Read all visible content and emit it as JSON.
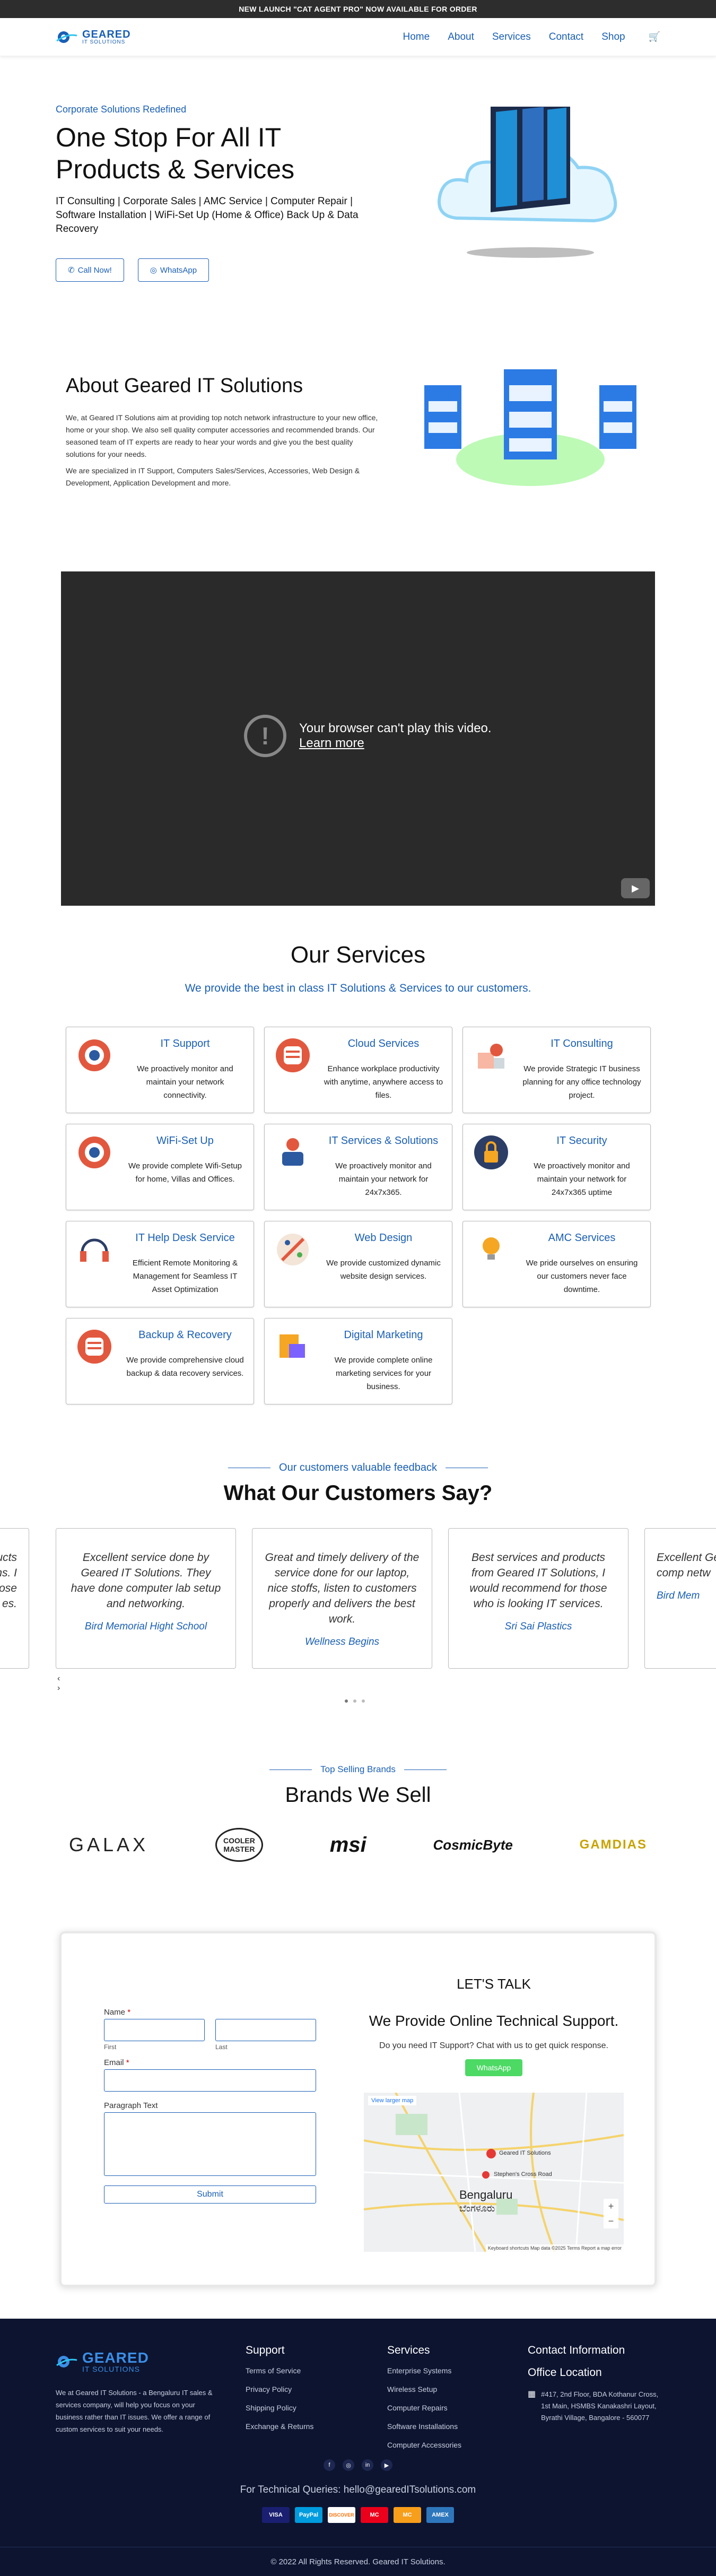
{
  "topbar": {
    "text": "NEW LAUNCH \"CAT AGENT PRO\" NOW AVAILABLE FOR ORDER"
  },
  "header": {
    "logo_line1": "GEARED",
    "logo_line2": "IT SOLUTIONS",
    "nav": [
      "Home",
      "About",
      "Services",
      "Contact",
      "Shop"
    ]
  },
  "hero": {
    "eyebrow": "Corporate Solutions Redefined",
    "title": "One Stop For All IT Products & Services",
    "desc": "IT Consulting | Corporate Sales | AMC Service | Computer Repair | Software Installation | WiFi-Set Up (Home & Office) Back Up & Data Recovery",
    "btn_call": "Call Now!",
    "btn_whatsapp": "WhatsApp"
  },
  "about": {
    "title": "About Geared IT Solutions",
    "p1": "We, at Geared IT Solutions aim at providing top notch network infrastructure to your new office, home or your shop. We also sell quality computer accessories and recommended brands. Our seasoned team of IT experts are ready to hear your words and give you the best quality solutions for your needs.",
    "p2": "We are specialized in IT Support, Computers Sales/Services, Accessories, Web Design & Development, Application Development and more."
  },
  "video": {
    "msg1": "Your browser can't play this video.",
    "msg2": "Learn more"
  },
  "services": {
    "title": "Our Services",
    "subtitle": "We provide the best in class IT Solutions & Services to our customers.",
    "items": [
      {
        "title": "IT Support",
        "desc": "We proactively monitor and maintain your network connectivity.",
        "icon": "gear-icon",
        "color": "#e2583e"
      },
      {
        "title": "Cloud Services",
        "desc": "Enhance workplace productivity with anytime, anywhere access to files.",
        "icon": "database-icon",
        "color": "#e2583e"
      },
      {
        "title": "IT Consulting",
        "desc": "We provide Strategic IT business planning for any office technology project.",
        "icon": "consulting-icon",
        "color": "#e2583e"
      },
      {
        "title": "WiFi-Set Up",
        "desc": "We provide complete Wifi-Setup for home, Villas and Offices.",
        "icon": "gear-icon",
        "color": "#e2583e"
      },
      {
        "title": "IT Services & Solutions",
        "desc": "We proactively monitor and maintain your network for 24x7x365.",
        "icon": "technician-icon",
        "color": "#e2583e"
      },
      {
        "title": "IT Security",
        "desc": "We proactively monitor and maintain your network for 24x7x365 uptime",
        "icon": "lock-icon",
        "color": "#f5a623"
      },
      {
        "title": "IT Help Desk Service",
        "desc": "Efficient Remote Monitoring & Management for Seamless IT Asset Optimization",
        "icon": "headset-icon",
        "color": "#e2583e"
      },
      {
        "title": "Web Design",
        "desc": "We provide customized dynamic website design services.",
        "icon": "design-icon",
        "color": "#e2583e"
      },
      {
        "title": "AMC Services",
        "desc": "We pride ourselves on ensuring our customers never face downtime.",
        "icon": "bulb-icon",
        "color": "#f5a623"
      },
      {
        "title": "Backup & Recovery",
        "desc": "We provide comprehensive cloud backup & data recovery services.",
        "icon": "database-icon",
        "color": "#e2583e"
      },
      {
        "title": "Digital Marketing",
        "desc": "We provide complete online marketing services for your business.",
        "icon": "marketing-icon",
        "color": "#f5a623"
      }
    ]
  },
  "testimonials": {
    "eyebrow": "Our customers valuable feedback",
    "title": "What Our Customers Say?",
    "items": [
      {
        "quote": "Excellent service done by Geared IT Solutions. They have done computer lab setup and networking.",
        "author": "Bird Memorial Hight School"
      },
      {
        "quote": "Great and timely delivery of the service done for our laptop, nice stoffs, listen to customers properly and delivers the best work.",
        "author": "Wellness Begins"
      },
      {
        "quote": "Best services and products from Geared IT Solutions, I would recommend for those who is looking IT services.",
        "author": "Sri Sai Plastics"
      }
    ],
    "partial_left": [
      "ucts",
      "ns. I",
      "hose",
      "es."
    ],
    "partial_right": {
      "quote": "Excellent Geared IT S done comp netw",
      "author": "Bird Mem"
    },
    "prev": "‹",
    "next": "›"
  },
  "brands": {
    "eyebrow": "Top Selling Brands",
    "title": "Brands We Sell",
    "items": [
      "GALAX",
      "COOLER MASTER",
      "msi",
      "CosmicByte",
      "GAMDIAS"
    ]
  },
  "contact": {
    "name_label": "Name",
    "first": "First",
    "last": "Last",
    "email_label": "Email",
    "text_label": "Paragraph Text",
    "submit": "Submit",
    "talk_title": "LET'S TALK",
    "talk_heading": "We Provide Online Technical Support.",
    "talk_desc": "Do you need IT Support? Chat with us to get quick response.",
    "wa": "WhatsApp",
    "map_link": "View larger map",
    "map_pin": "Geared IT Solutions",
    "map_city": "Bengaluru",
    "map_city_kn": "ಬೆಂಗಳೂರು",
    "map_road": "Stephen's Cross Road",
    "map_footer": "Keyboard shortcuts  Map data ©2025  Terms  Report a map error"
  },
  "footer": {
    "logo_line1": "GEARED",
    "logo_line2": "IT SOLUTIONS",
    "about": "We at Geared IT Solutions - a Bengaluru IT sales & services company, will help you focus on your business rather than IT issues. We offer a range of custom services to suit your needs.",
    "support_title": "Support",
    "support": [
      "Terms of Service",
      "Privacy Policy",
      "Shipping Policy",
      "Exchange & Returns"
    ],
    "services_title": "Services",
    "services": [
      "Enterprise Systems",
      "Wireless Setup",
      "Computer Repairs",
      "Software Installations",
      "Computer Accessories"
    ],
    "contact_title": "Contact Information",
    "office_title": "Office Location",
    "address": "#417, 2nd Floor, BDA Kothanur Cross, 1st Main, HSMBS Kanakashri Layout, Byrathi Village, Bangalore - 560077",
    "tech": "For Technical Queries: hello@gearedITsolutions.com",
    "pay": [
      "VISA",
      "PayPal",
      "DISCOVER",
      "MC",
      "MC",
      "AMEX"
    ],
    "copyright": "© 2022 All Rights Reserved. Geared IT Solutions."
  }
}
